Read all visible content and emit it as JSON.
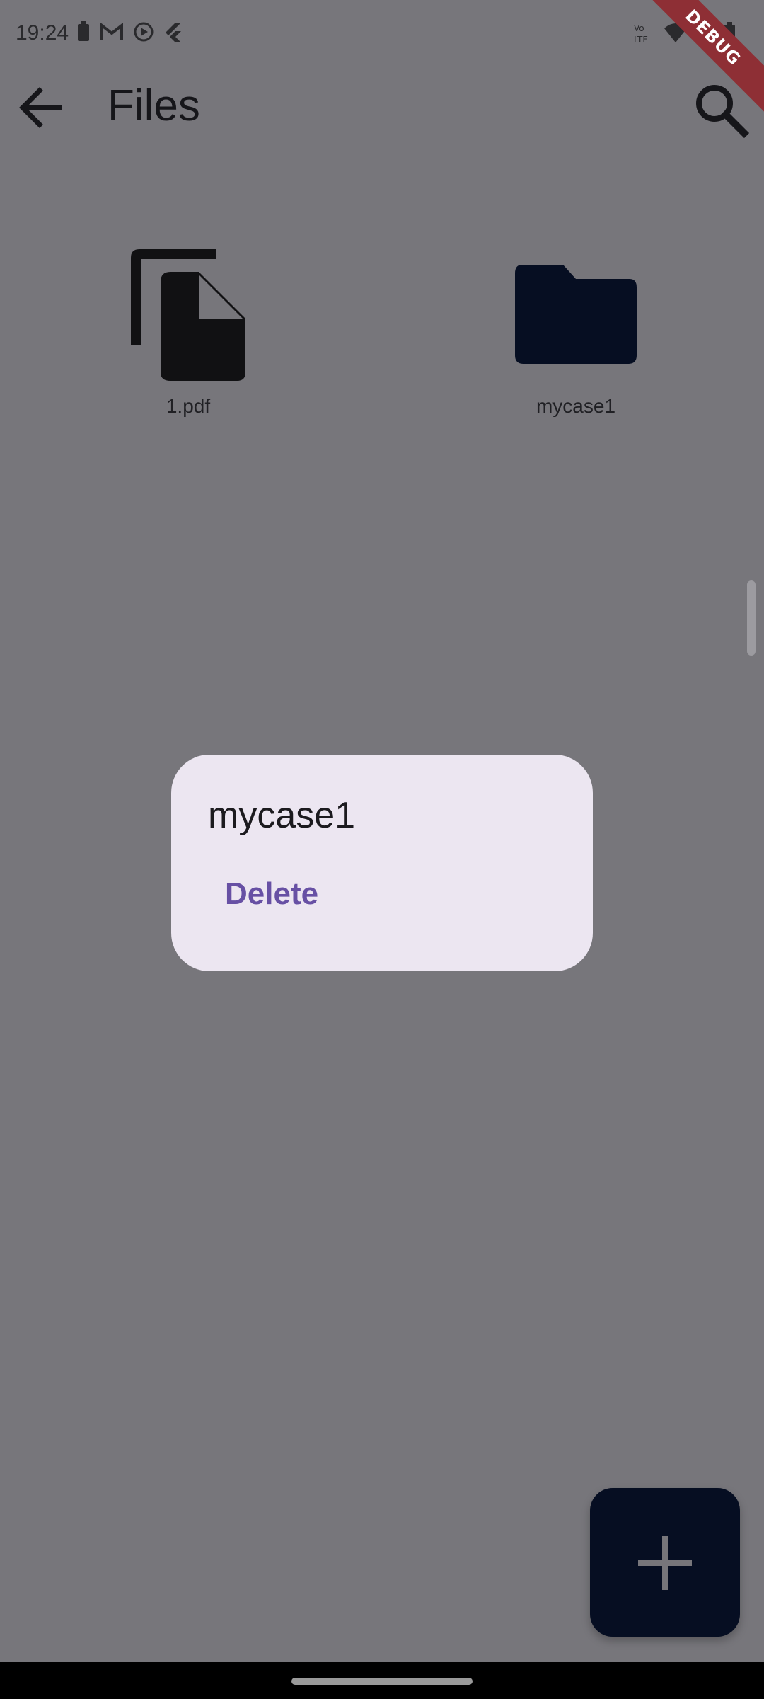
{
  "status_bar": {
    "time": "19:24",
    "debug_banner": "DEBUG",
    "left_icons": [
      "battery-saver-icon",
      "gmail-icon",
      "play-icon",
      "flutter-icon"
    ],
    "right_icons": [
      "volte-icon",
      "wifi-icon",
      "signal-icon",
      "battery-icon"
    ]
  },
  "app_bar": {
    "title": "Files"
  },
  "files": [
    {
      "name": "1.pdf",
      "icon": "file-copy-icon"
    },
    {
      "name": "mycase1",
      "icon": "folder-icon"
    }
  ],
  "dialog": {
    "title": "mycase1",
    "options": [
      "Delete"
    ]
  },
  "fab": {
    "icon": "add-icon"
  },
  "colors": {
    "scrim_background": "#77767b",
    "dialog_background": "#ece6f1",
    "accent": "#6750a4",
    "fab_background": "#060e22",
    "folder_color": "#060e22",
    "debug_ribbon": "#8e2f35"
  }
}
